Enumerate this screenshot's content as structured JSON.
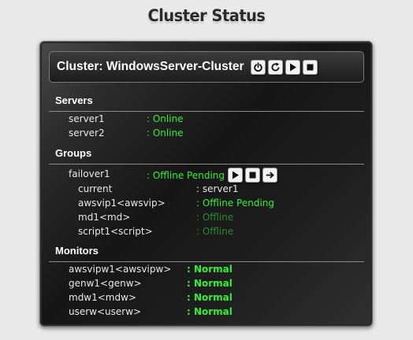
{
  "page": {
    "title": "Cluster Status"
  },
  "cluster": {
    "name": "Cluster: WindowsServer-Cluster",
    "buttons": [
      {
        "name": "power-button",
        "icon": "power-icon"
      },
      {
        "name": "restart-button",
        "icon": "restart-icon"
      },
      {
        "name": "start-button",
        "icon": "play-icon"
      },
      {
        "name": "stop-button",
        "icon": "stop-icon"
      }
    ]
  },
  "servers": {
    "title": "Servers",
    "items": [
      {
        "name": "server1",
        "status": ": Online"
      },
      {
        "name": "server2",
        "status": ": Online"
      }
    ]
  },
  "groups": {
    "title": "Groups",
    "group": {
      "name": "failover1",
      "status": ": Offline Pending",
      "buttons": [
        "play-icon",
        "stop-icon",
        "move-icon"
      ]
    },
    "resources": [
      {
        "name": "current",
        "status": ": server1"
      },
      {
        "name": "awsvip1<awsvip>",
        "status": ": Offline Pending"
      },
      {
        "name": "md1<md>",
        "status": ": Offline"
      },
      {
        "name": "script1<script>",
        "status": ": Offline"
      }
    ]
  },
  "monitors": {
    "title": "Monitors",
    "items": [
      {
        "name": "awsvipw1<awsvipw>",
        "status": ": Normal"
      },
      {
        "name": "genw1<genw>",
        "status": ": Normal"
      },
      {
        "name": "mdw1<mdw>",
        "status": ": Normal"
      },
      {
        "name": "userw<userw>",
        "status": ": Normal"
      }
    ]
  },
  "colors": {
    "online": "#34ef34",
    "offline": "#2e8a2e",
    "text": "#e8e8e8",
    "background": "#e9e9e9"
  }
}
